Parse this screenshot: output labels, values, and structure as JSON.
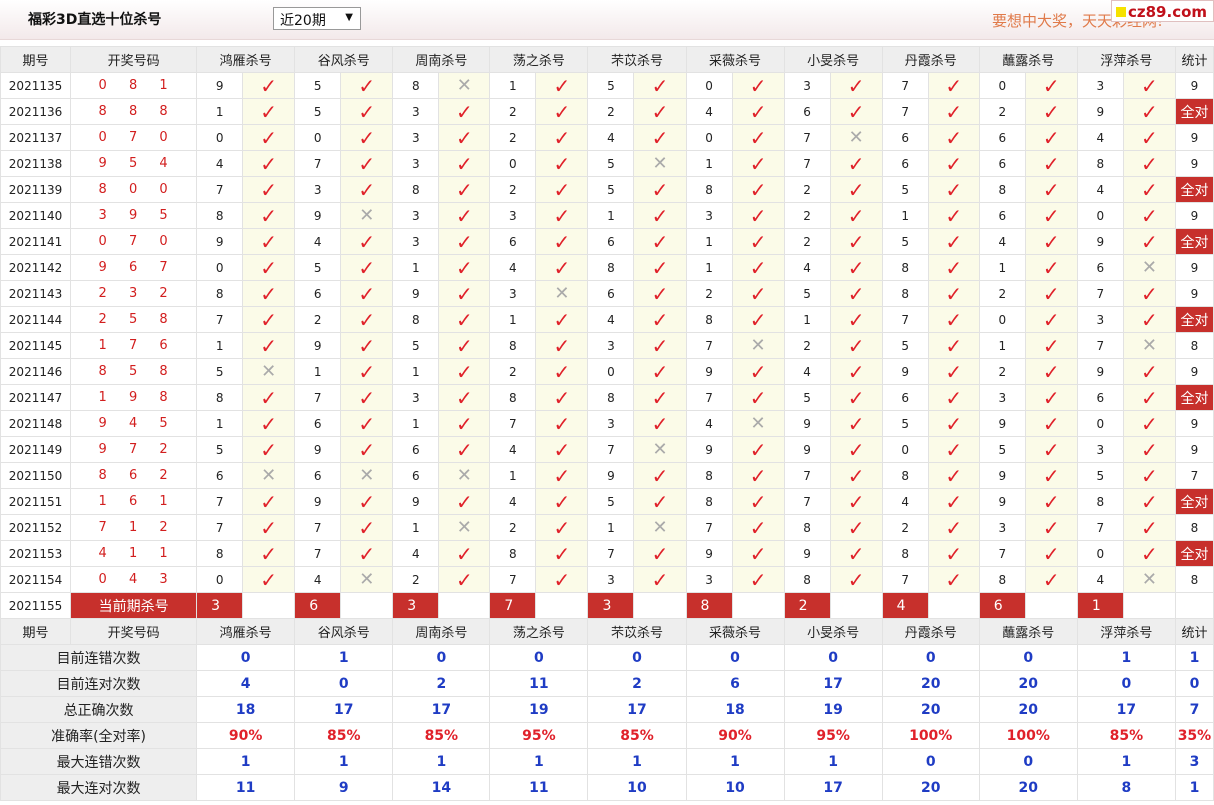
{
  "header": {
    "title": "福彩3D直选十位杀号",
    "range_select": "近20期",
    "marquee": "要想中大奖，天天彩经网!",
    "site_badge": "cz89.com"
  },
  "columns": {
    "period": "期号",
    "draw": "开奖号码",
    "experts": [
      "鸿雁杀号",
      "谷风杀号",
      "周南杀号",
      "荡之杀号",
      "芣苡杀号",
      "采薇杀号",
      "小旻杀号",
      "丹霞杀号",
      "蘸露杀号",
      "浮萍杀号"
    ],
    "stats": "统计"
  },
  "rows": [
    {
      "p": "2021135",
      "d": "0 8 1",
      "k": [
        "9",
        "5",
        "8",
        "1",
        "5",
        "0",
        "3",
        "7",
        "0",
        "3"
      ],
      "r": [
        1,
        1,
        0,
        1,
        1,
        1,
        1,
        1,
        1,
        1
      ],
      "s": "9"
    },
    {
      "p": "2021136",
      "d": "8 8 8",
      "k": [
        "1",
        "5",
        "3",
        "2",
        "2",
        "4",
        "6",
        "7",
        "2",
        "9"
      ],
      "r": [
        1,
        1,
        1,
        1,
        1,
        1,
        1,
        1,
        1,
        1
      ],
      "s": "全对"
    },
    {
      "p": "2021137",
      "d": "0 7 0",
      "k": [
        "0",
        "0",
        "3",
        "2",
        "4",
        "0",
        "7",
        "6",
        "6",
        "4"
      ],
      "r": [
        1,
        1,
        1,
        1,
        1,
        1,
        0,
        1,
        1,
        1
      ],
      "s": "9"
    },
    {
      "p": "2021138",
      "d": "9 5 4",
      "k": [
        "4",
        "7",
        "3",
        "0",
        "5",
        "1",
        "7",
        "6",
        "6",
        "8"
      ],
      "r": [
        1,
        1,
        1,
        1,
        0,
        1,
        1,
        1,
        1,
        1
      ],
      "s": "9"
    },
    {
      "p": "2021139",
      "d": "8 0 0",
      "k": [
        "7",
        "3",
        "8",
        "2",
        "5",
        "8",
        "2",
        "5",
        "8",
        "4"
      ],
      "r": [
        1,
        1,
        1,
        1,
        1,
        1,
        1,
        1,
        1,
        1
      ],
      "s": "全对"
    },
    {
      "p": "2021140",
      "d": "3 9 5",
      "k": [
        "8",
        "9",
        "3",
        "3",
        "1",
        "3",
        "2",
        "1",
        "6",
        "0"
      ],
      "r": [
        1,
        0,
        1,
        1,
        1,
        1,
        1,
        1,
        1,
        1
      ],
      "s": "9"
    },
    {
      "p": "2021141",
      "d": "0 7 0",
      "k": [
        "9",
        "4",
        "3",
        "6",
        "6",
        "1",
        "2",
        "5",
        "4",
        "9"
      ],
      "r": [
        1,
        1,
        1,
        1,
        1,
        1,
        1,
        1,
        1,
        1
      ],
      "s": "全对"
    },
    {
      "p": "2021142",
      "d": "9 6 7",
      "k": [
        "0",
        "5",
        "1",
        "4",
        "8",
        "1",
        "4",
        "8",
        "1",
        "6"
      ],
      "r": [
        1,
        1,
        1,
        1,
        1,
        1,
        1,
        1,
        1,
        0
      ],
      "s": "9"
    },
    {
      "p": "2021143",
      "d": "2 3 2",
      "k": [
        "8",
        "6",
        "9",
        "3",
        "6",
        "2",
        "5",
        "8",
        "2",
        "7"
      ],
      "r": [
        1,
        1,
        1,
        0,
        1,
        1,
        1,
        1,
        1,
        1
      ],
      "s": "9"
    },
    {
      "p": "2021144",
      "d": "2 5 8",
      "k": [
        "7",
        "2",
        "8",
        "1",
        "4",
        "8",
        "1",
        "7",
        "0",
        "3"
      ],
      "r": [
        1,
        1,
        1,
        1,
        1,
        1,
        1,
        1,
        1,
        1
      ],
      "s": "全对"
    },
    {
      "p": "2021145",
      "d": "1 7 6",
      "k": [
        "1",
        "9",
        "5",
        "8",
        "3",
        "7",
        "2",
        "5",
        "1",
        "7"
      ],
      "r": [
        1,
        1,
        1,
        1,
        1,
        0,
        1,
        1,
        1,
        0
      ],
      "s": "8"
    },
    {
      "p": "2021146",
      "d": "8 5 8",
      "k": [
        "5",
        "1",
        "1",
        "2",
        "0",
        "9",
        "4",
        "9",
        "2",
        "9"
      ],
      "r": [
        0,
        1,
        1,
        1,
        1,
        1,
        1,
        1,
        1,
        1
      ],
      "s": "9"
    },
    {
      "p": "2021147",
      "d": "1 9 8",
      "k": [
        "8",
        "7",
        "3",
        "8",
        "8",
        "7",
        "5",
        "6",
        "3",
        "6"
      ],
      "r": [
        1,
        1,
        1,
        1,
        1,
        1,
        1,
        1,
        1,
        1
      ],
      "s": "全对"
    },
    {
      "p": "2021148",
      "d": "9 4 5",
      "k": [
        "1",
        "6",
        "1",
        "7",
        "3",
        "4",
        "9",
        "5",
        "9",
        "0"
      ],
      "r": [
        1,
        1,
        1,
        1,
        1,
        0,
        1,
        1,
        1,
        1
      ],
      "s": "9"
    },
    {
      "p": "2021149",
      "d": "9 7 2",
      "k": [
        "5",
        "9",
        "6",
        "4",
        "7",
        "9",
        "9",
        "0",
        "5",
        "3"
      ],
      "r": [
        1,
        1,
        1,
        1,
        0,
        1,
        1,
        1,
        1,
        1
      ],
      "s": "9"
    },
    {
      "p": "2021150",
      "d": "8 6 2",
      "k": [
        "6",
        "6",
        "6",
        "1",
        "9",
        "8",
        "7",
        "8",
        "9",
        "5"
      ],
      "r": [
        0,
        0,
        0,
        1,
        1,
        1,
        1,
        1,
        1,
        1
      ],
      "s": "7"
    },
    {
      "p": "2021151",
      "d": "1 6 1",
      "k": [
        "7",
        "9",
        "9",
        "4",
        "5",
        "8",
        "7",
        "4",
        "9",
        "8"
      ],
      "r": [
        1,
        1,
        1,
        1,
        1,
        1,
        1,
        1,
        1,
        1
      ],
      "s": "全对"
    },
    {
      "p": "2021152",
      "d": "7 1 2",
      "k": [
        "7",
        "7",
        "1",
        "2",
        "1",
        "7",
        "8",
        "2",
        "3",
        "7"
      ],
      "r": [
        1,
        1,
        0,
        1,
        0,
        1,
        1,
        1,
        1,
        1
      ],
      "s": "8"
    },
    {
      "p": "2021153",
      "d": "4 1 1",
      "k": [
        "8",
        "7",
        "4",
        "8",
        "7",
        "9",
        "9",
        "8",
        "7",
        "0"
      ],
      "r": [
        1,
        1,
        1,
        1,
        1,
        1,
        1,
        1,
        1,
        1
      ],
      "s": "全对"
    },
    {
      "p": "2021154",
      "d": "0 4 3",
      "k": [
        "0",
        "4",
        "2",
        "7",
        "3",
        "3",
        "8",
        "7",
        "8",
        "4"
      ],
      "r": [
        1,
        0,
        1,
        1,
        1,
        1,
        1,
        1,
        1,
        0
      ],
      "s": "8"
    }
  ],
  "current": {
    "p": "2021155",
    "label": "当前期杀号",
    "k": [
      "3",
      "6",
      "3",
      "7",
      "3",
      "8",
      "2",
      "4",
      "6",
      "1"
    ]
  },
  "stats": [
    {
      "label": "目前连错次数",
      "v": [
        "0",
        "1",
        "0",
        "0",
        "0",
        "0",
        "0",
        "0",
        "0",
        "1"
      ],
      "s": "1",
      "cls": "blue"
    },
    {
      "label": "目前连对次数",
      "v": [
        "4",
        "0",
        "2",
        "11",
        "2",
        "6",
        "17",
        "20",
        "20",
        "0"
      ],
      "s": "0",
      "cls": "blue"
    },
    {
      "label": "总正确次数",
      "v": [
        "18",
        "17",
        "17",
        "19",
        "17",
        "18",
        "19",
        "20",
        "20",
        "17"
      ],
      "s": "7",
      "cls": "blue"
    },
    {
      "label": "准确率(全对率)",
      "v": [
        "90%",
        "85%",
        "85%",
        "95%",
        "85%",
        "90%",
        "95%",
        "100%",
        "100%",
        "85%"
      ],
      "s": "35%",
      "cls": "redv"
    },
    {
      "label": "最大连错次数",
      "v": [
        "1",
        "1",
        "1",
        "1",
        "1",
        "1",
        "1",
        "0",
        "0",
        "1"
      ],
      "s": "3",
      "cls": "blue"
    },
    {
      "label": "最大连对次数",
      "v": [
        "11",
        "9",
        "14",
        "11",
        "10",
        "10",
        "17",
        "20",
        "20",
        "8"
      ],
      "s": "1",
      "cls": "blue"
    }
  ],
  "icons": {
    "correct": "check-icon",
    "wrong": "cross-icon"
  },
  "colors": {
    "accent_red": "#c7302c",
    "check": "#e0212a",
    "value_blue": "#1f3cc4"
  }
}
